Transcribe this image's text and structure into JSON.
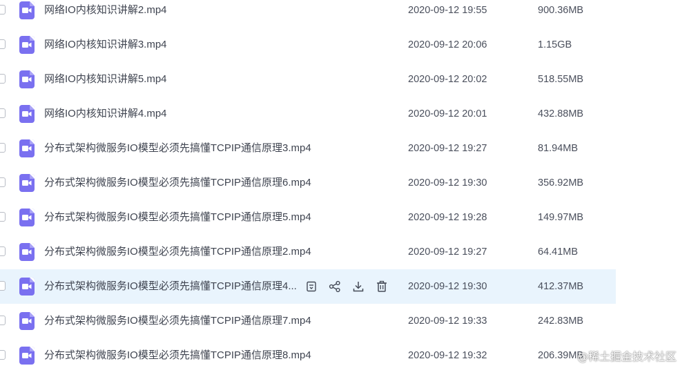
{
  "files": [
    {
      "name": "网络IO内核知识讲解2.mp4",
      "modified": "2020-09-12 19:55",
      "size": "900.36MB",
      "icon": "video-file-icon"
    },
    {
      "name": "网络IO内核知识讲解3.mp4",
      "modified": "2020-09-12 20:06",
      "size": "1.15GB",
      "icon": "video-file-icon"
    },
    {
      "name": "网络IO内核知识讲解5.mp4",
      "modified": "2020-09-12 20:02",
      "size": "518.55MB",
      "icon": "video-file-icon"
    },
    {
      "name": "网络IO内核知识讲解4.mp4",
      "modified": "2020-09-12 20:01",
      "size": "432.88MB",
      "icon": "video-file-icon"
    },
    {
      "name": "分布式架构微服务IO模型必须先搞懂TCPIP通信原理3.mp4",
      "modified": "2020-09-12 19:27",
      "size": "81.94MB",
      "icon": "video-file-icon"
    },
    {
      "name": "分布式架构微服务IO模型必须先搞懂TCPIP通信原理6.mp4",
      "modified": "2020-09-12 19:30",
      "size": "356.92MB",
      "icon": "video-file-icon"
    },
    {
      "name": "分布式架构微服务IO模型必须先搞懂TCPIP通信原理5.mp4",
      "modified": "2020-09-12 19:28",
      "size": "149.97MB",
      "icon": "video-file-icon"
    },
    {
      "name": "分布式架构微服务IO模型必须先搞懂TCPIP通信原理2.mp4",
      "modified": "2020-09-12 19:27",
      "size": "64.41MB",
      "icon": "video-file-icon"
    },
    {
      "name": "分布式架构微服务IO模型必须先搞懂TCPIP通信原理4...",
      "modified": "2020-09-12 19:30",
      "size": "412.37MB",
      "icon": "video-file-icon",
      "hovered": true
    },
    {
      "name": "分布式架构微服务IO模型必须先搞懂TCPIP通信原理7.mp4",
      "modified": "2020-09-12 19:33",
      "size": "242.83MB",
      "icon": "video-file-icon"
    },
    {
      "name": "分布式架构微服务IO模型必须先搞懂TCPIP通信原理8.mp4",
      "modified": "2020-09-12 19:32",
      "size": "206.39MB",
      "icon": "video-file-icon"
    }
  ],
  "row_actions": [
    {
      "icon": "save-to-folder-icon"
    },
    {
      "icon": "share-icon"
    },
    {
      "icon": "download-icon"
    },
    {
      "icon": "delete-icon"
    }
  ],
  "colors": {
    "icon_purple": "#7a70f0",
    "hover_row": "#e9f4fd",
    "text": "#3f4450"
  },
  "watermark": "@稀土掘金技术社区"
}
